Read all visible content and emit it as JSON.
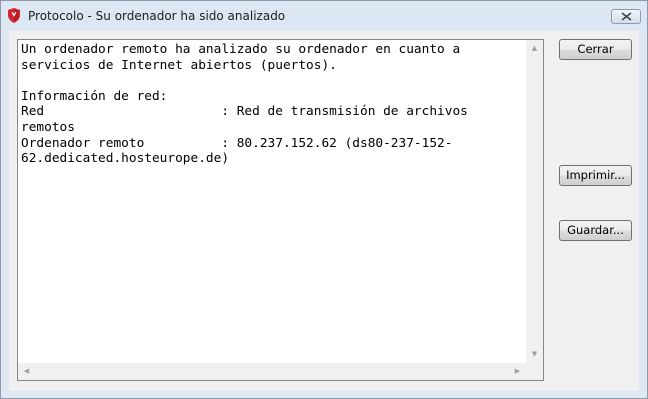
{
  "window": {
    "title": "Protocolo - Su ordenador ha sido analizado",
    "app_icon": "shield-icon",
    "close_icon": "close-icon"
  },
  "log": {
    "text": "Un ordenador remoto ha analizado su ordenador en cuanto a\nservicios de Internet abiertos (puertos).\n\nInformación de red:\nRed                       : Red de transmisión de archivos\nremotos\nOrdenador remoto          : 80.237.152.62 (ds80-237-152-\n62.dedicated.hosteurope.de)"
  },
  "buttons": {
    "close_label": "Cerrar",
    "print_label": "Imprimir...",
    "save_label": "Guardar..."
  },
  "colors": {
    "accent_icon": "#d3262e",
    "window_frame": "#dfe8f3",
    "client_bg": "#f0f0f0"
  }
}
